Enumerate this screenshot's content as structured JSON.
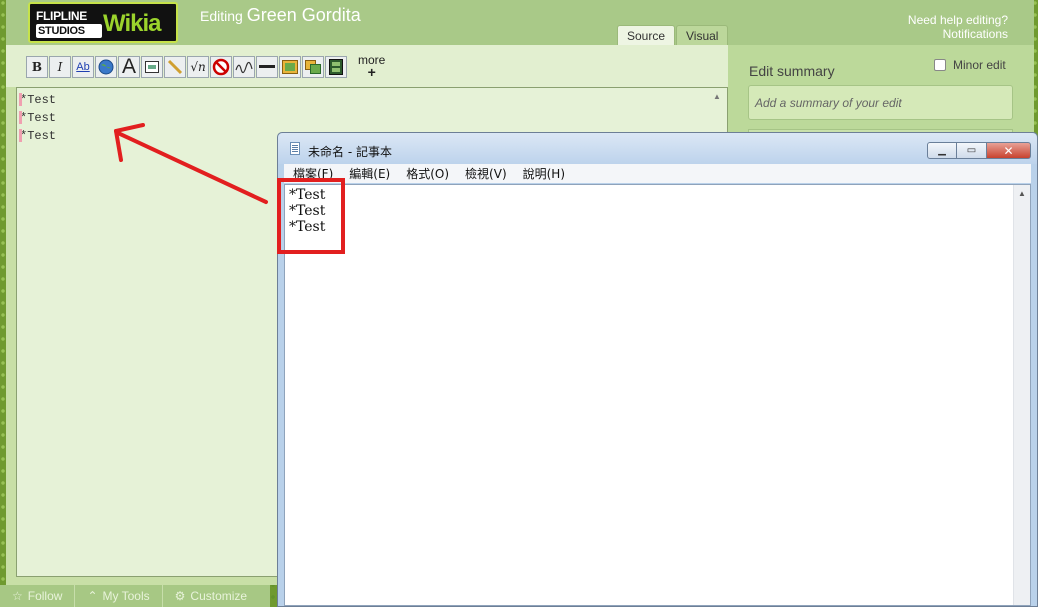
{
  "wiki": {
    "logo": {
      "line1": "FLIPLINE",
      "line2": "STUDIOS",
      "brand": "Wikia"
    },
    "editing_prefix": "Editing",
    "page_title": "Green Gordita",
    "help_link": "Need help editing?",
    "notifications_link": "Notifications",
    "tabs": {
      "source": "Source",
      "visual": "Visual"
    },
    "toolbar": {
      "bold": "B",
      "italic": "I",
      "link": "Ab",
      "bigA": "A",
      "more_label": "more",
      "more_plus": "+"
    },
    "editor_lines": [
      "*Test",
      "*Test",
      "*Test"
    ],
    "edit_summary_title": "Edit summary",
    "minor_edit_label": "Minor edit",
    "summary_placeholder": "Add a summary of your edit",
    "bottom_bar": {
      "follow": "Follow",
      "my_tools": "My Tools",
      "customize": "Customize"
    }
  },
  "notepad": {
    "title": "未命名 - 記事本",
    "menu": [
      "檔案(F)",
      "編輯(E)",
      "格式(O)",
      "檢視(V)",
      "說明(H)"
    ],
    "lines": [
      "*Test",
      "*Test",
      "*Test"
    ]
  },
  "colors": {
    "annotation_red": "#e21f1f",
    "wiki_green": "#a9c988",
    "editor_bg": "#e6f2d7"
  }
}
